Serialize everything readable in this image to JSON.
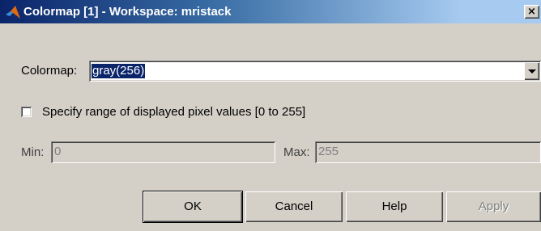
{
  "window": {
    "title": "Colormap [1] - Workspace: mristack",
    "close_glyph": "×",
    "icon": "matlab-icon"
  },
  "colormap": {
    "label": "Colormap:",
    "selected": "gray(256)"
  },
  "range": {
    "checkbox_label": "Specify range of displayed pixel values [0 to 255]",
    "checked": false
  },
  "min": {
    "label": "Min:",
    "value": "0"
  },
  "max": {
    "label": "Max:",
    "value": "255"
  },
  "buttons": {
    "ok": "OK",
    "cancel": "Cancel",
    "help": "Help",
    "apply": "Apply"
  },
  "colors": {
    "title_start": "#0a246a",
    "title_end": "#a6caf0",
    "dialog_face": "#d4d0c8",
    "selection": "#0a246a"
  }
}
